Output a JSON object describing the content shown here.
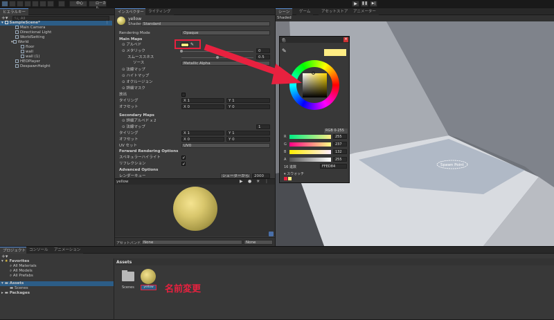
{
  "toolbar": {
    "center_label": "中心",
    "local_label": "ローカル"
  },
  "hierarchy": {
    "tab": "ヒエラルキー",
    "search_placeholder": "All",
    "items": [
      {
        "label": "SampleScene*"
      },
      {
        "label": "Main Camera"
      },
      {
        "label": "Directional Light"
      },
      {
        "label": "WorldSetting"
      },
      {
        "label": "World"
      },
      {
        "label": "floor"
      },
      {
        "label": "wall"
      },
      {
        "label": "wall (1)"
      },
      {
        "label": "HEOPlayer"
      },
      {
        "label": "DespawnHeight"
      }
    ]
  },
  "inspector": {
    "tabs": [
      "インスペクター",
      "ライティング"
    ],
    "material_name": "yellow",
    "shader_label": "Shader",
    "shader_value": "Standard",
    "rendering_mode_label": "Rendering Mode",
    "rendering_mode_value": "Opaque",
    "main_maps": "Main Maps",
    "albedo": "アルベド",
    "metallic": "メタリック",
    "metallic_value": "0",
    "smoothness": "スムーススネス",
    "smoothness_value": "0.5",
    "source": "ソース",
    "source_value": "Metallic Alpha",
    "normal_map": "法線マップ",
    "height_map": "ハイトマップ",
    "occlusion": "オクルージョン",
    "detail_mask": "詳細マスク",
    "emission": "放出",
    "tiling": "タイリング",
    "offset": "オフセット",
    "x_label": "X",
    "y_label": "Y",
    "tiling_x": "1",
    "tiling_y": "1",
    "offset_x": "0",
    "offset_y": "0",
    "secondary_maps": "Secondary Maps",
    "detail_albedo": "詳細アルベド x 2",
    "detail_normal": "法線マップ",
    "detail_normal_value": "1",
    "tiling2_x": "1",
    "tiling2_y": "1",
    "offset2_x": "0",
    "offset2_y": "0",
    "uv_set": "UV セット",
    "uv_set_value": "UV0",
    "forward_options": "Forward Rendering Options",
    "specular_highlights": "スペキュラーハイライト",
    "reflections": "リフレクション",
    "advanced_options": "Advanced Options",
    "render_queue": "レンダーキュー",
    "render_queue_mode": "シェーダーから",
    "render_queue_value": "2000",
    "preview_name": "yellow",
    "asset_bundle_label": "アセットバンドル",
    "asset_bundle_value": "None",
    "asset_bundle_variant": "None"
  },
  "scene": {
    "tabs": [
      "シーン",
      "ゲーム",
      "アセットストア",
      "アニメーター"
    ],
    "shading": "Shaded",
    "spawn_point": "Spawn Point"
  },
  "color_picker": {
    "title": "色",
    "mode": "RGB 0-255",
    "channels": [
      {
        "label": "R",
        "value": "255"
      },
      {
        "label": "G",
        "value": "237"
      },
      {
        "label": "B",
        "value": "132"
      },
      {
        "label": "A",
        "value": "255"
      }
    ],
    "hex_label": "16 進数",
    "hex_value": "FFED84",
    "swatches_label": "スウォッチ",
    "colors": {
      "selected": "#FFED84"
    }
  },
  "project": {
    "tabs": [
      "プロジェクト",
      "コンソール",
      "アニメーション"
    ],
    "favorites": "Favorites",
    "favorite_items": [
      "All Materials",
      "All Models",
      "All Prefabs"
    ],
    "assets_root": "Assets",
    "assets_children": [
      "Scenes"
    ],
    "packages": "Packages",
    "breadcrumb": "Assets",
    "grid_items": [
      {
        "label": "Scenes"
      },
      {
        "label": "yellow"
      }
    ]
  },
  "annotation": {
    "rename_label": "名前変更",
    "color": "#e8213f"
  }
}
